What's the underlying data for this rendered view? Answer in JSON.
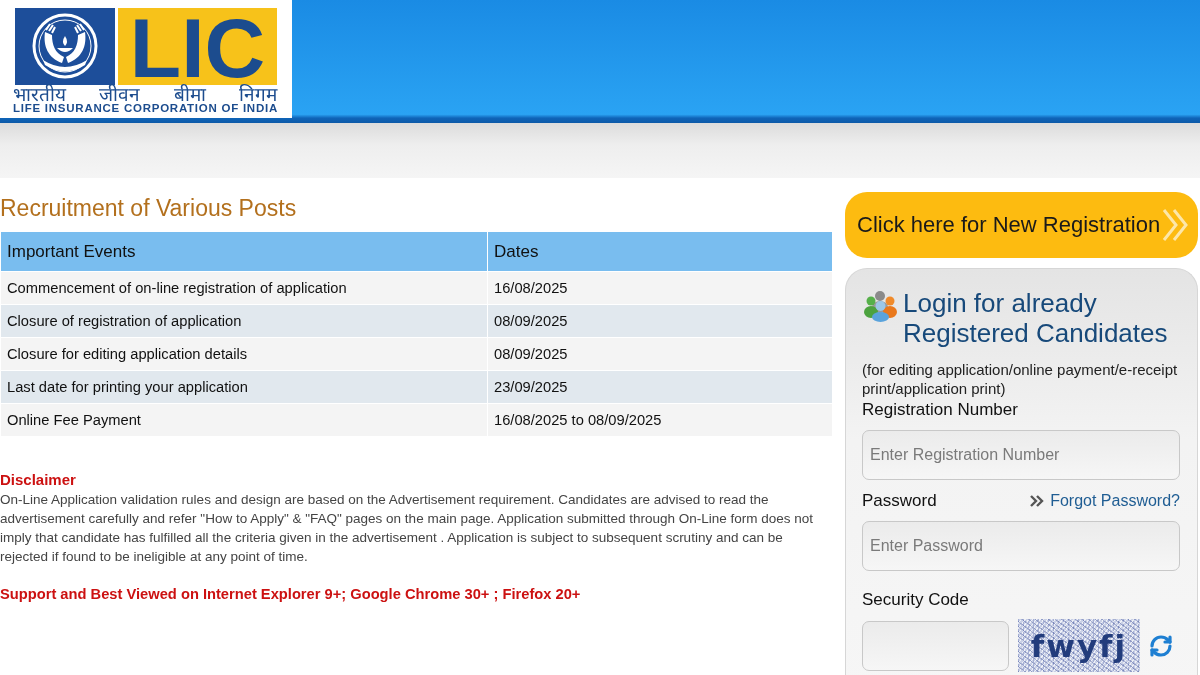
{
  "header": {
    "logo": {
      "mark": "LIC",
      "hindi_name": "भारतीय जीवन बीमा निगम",
      "english_name": "LIFE INSURANCE CORPORATION OF INDIA"
    }
  },
  "main": {
    "title": "Recruitment of Various Posts",
    "table": {
      "columns": [
        "Important Events",
        "Dates"
      ],
      "rows": [
        {
          "event": "Commencement of on-line registration of application",
          "date": "16/08/2025"
        },
        {
          "event": "Closure of registration of application",
          "date": "08/09/2025"
        },
        {
          "event": "Closure for editing application details",
          "date": "08/09/2025"
        },
        {
          "event": "Last date for printing your application",
          "date": "23/09/2025"
        },
        {
          "event": "Online Fee Payment",
          "date": "16/08/2025 to 08/09/2025"
        }
      ]
    },
    "disclaimer": {
      "heading": "Disclaimer",
      "text": "On-Line Application validation rules and design are based on the Advertisement requirement. Candidates are advised to read the advertisement carefully and refer \"How to Apply\" & \"FAQ\" pages on the main page. Application submitted through On-Line form does not imply that candidate has fulfilled all the criteria given in the advertisement . Application is subject to subsequent scrutiny and can be rejected if found to be ineligible at any point of time."
    },
    "browser_note": "Support and Best Viewed on Internet Explorer 9+; Google Chrome 30+ ; Firefox 20+"
  },
  "sidebar": {
    "new_registration_button": "Click here for New Registration",
    "login": {
      "title": "Login for already Registered Candidates",
      "subtitle": "(for editing application/online payment/e-receipt print/application print)",
      "fields": [
        {
          "kind": "text",
          "label": "Registration Number",
          "placeholder": "Enter Registration Number"
        },
        {
          "kind": "password",
          "label": "Password",
          "placeholder": "Enter Password",
          "link": "Forgot Password?"
        },
        {
          "kind": "captcha",
          "label": "Security Code",
          "captcha": "fwyfj"
        }
      ]
    }
  }
}
